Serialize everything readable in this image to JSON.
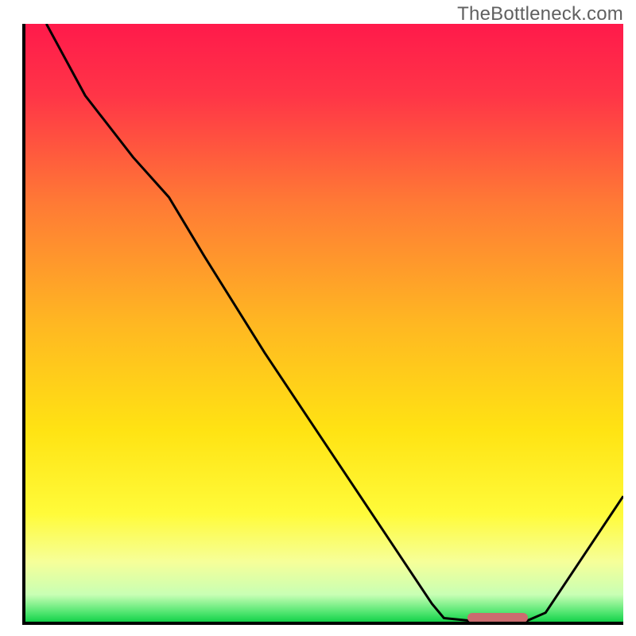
{
  "attribution": "TheBottleneck.com",
  "chart_data": {
    "type": "line",
    "title": "",
    "xlabel": "",
    "ylabel": "",
    "x_range": [
      0,
      100
    ],
    "y_range": [
      0,
      100
    ],
    "gradient_stops": [
      {
        "offset": 0.0,
        "color": "#ff1a4b"
      },
      {
        "offset": 0.12,
        "color": "#ff3547"
      },
      {
        "offset": 0.3,
        "color": "#ff7a35"
      },
      {
        "offset": 0.5,
        "color": "#ffb722"
      },
      {
        "offset": 0.68,
        "color": "#ffe313"
      },
      {
        "offset": 0.82,
        "color": "#fffb3a"
      },
      {
        "offset": 0.9,
        "color": "#f6ff99"
      },
      {
        "offset": 0.955,
        "color": "#c8ffb4"
      },
      {
        "offset": 0.985,
        "color": "#4fe56f"
      },
      {
        "offset": 1.0,
        "color": "#15d24a"
      }
    ],
    "series": [
      {
        "name": "bottleneck-curve",
        "color": "#000000",
        "width": 3,
        "points": [
          {
            "x": 3.5,
            "y": 100.0
          },
          {
            "x": 10.0,
            "y": 88.0
          },
          {
            "x": 18.0,
            "y": 77.7
          },
          {
            "x": 24.0,
            "y": 71.0
          },
          {
            "x": 30.0,
            "y": 61.0
          },
          {
            "x": 40.0,
            "y": 45.0
          },
          {
            "x": 50.0,
            "y": 30.0
          },
          {
            "x": 60.0,
            "y": 15.0
          },
          {
            "x": 68.0,
            "y": 3.0
          },
          {
            "x": 70.0,
            "y": 0.6
          },
          {
            "x": 74.0,
            "y": 0.2
          },
          {
            "x": 84.0,
            "y": 0.2
          },
          {
            "x": 87.0,
            "y": 1.5
          },
          {
            "x": 92.0,
            "y": 9.0
          },
          {
            "x": 100.0,
            "y": 21.0
          }
        ]
      }
    ],
    "optimal_marker": {
      "x_start": 74.0,
      "x_end": 84.0,
      "y": 0.6,
      "color": "#cc6b6f"
    }
  }
}
